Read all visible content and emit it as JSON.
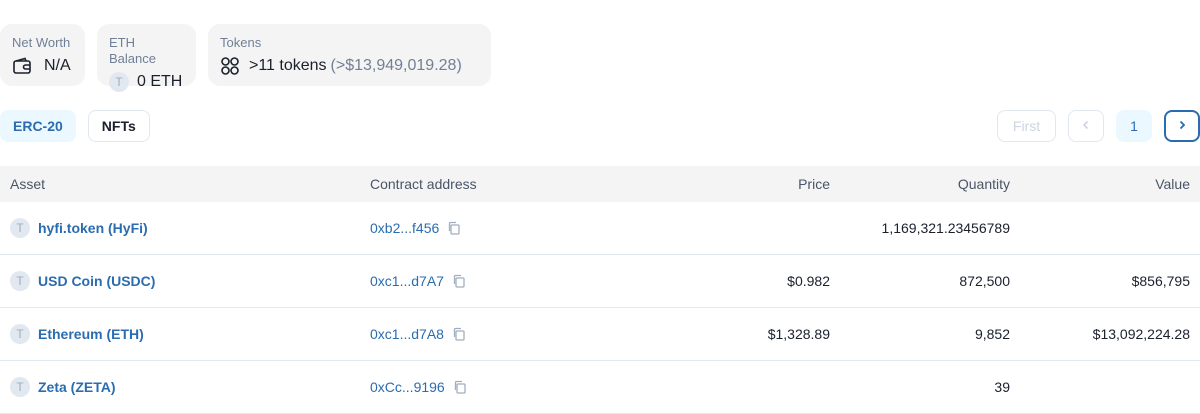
{
  "stats": {
    "net_worth": {
      "label": "Net Worth",
      "value": "N/A",
      "icon": "wallet-icon"
    },
    "eth_balance": {
      "label": "ETH Balance",
      "badge": "T",
      "value": "0 ETH"
    },
    "tokens": {
      "label": "Tokens",
      "count": ">11 tokens",
      "amount": "(>$13,949,019.28)",
      "icon": "tokens-icon"
    }
  },
  "tabs": [
    {
      "label": "ERC-20",
      "active": true
    },
    {
      "label": "NFTs",
      "active": false
    }
  ],
  "pagination": {
    "first": "First",
    "current_page": "1"
  },
  "table": {
    "headers": {
      "asset": "Asset",
      "contract": "Contract address",
      "price": "Price",
      "quantity": "Quantity",
      "value": "Value"
    },
    "rows": [
      {
        "badge": "T",
        "asset": "hyfi.token (HyFi)",
        "contract": "0xb2...f456",
        "price": "",
        "quantity": "1,169,321.23456789",
        "value": ""
      },
      {
        "badge": "T",
        "asset": "USD Coin (USDC)",
        "contract": "0xc1...d7A7",
        "price": "$0.982",
        "quantity": "872,500",
        "value": "$856,795"
      },
      {
        "badge": "T",
        "asset": "Ethereum (ETH)",
        "contract": "0xc1...d7A8",
        "price": "$1,328.89",
        "quantity": "9,852",
        "value": "$13,092,224.28"
      },
      {
        "badge": "T",
        "asset": "Zeta (ZETA)",
        "contract": "0xCc...9196",
        "price": "",
        "quantity": "39",
        "value": ""
      }
    ]
  },
  "colors": {
    "accent": "#2b6cb0",
    "muted": "#718096",
    "panel": "#f4f4f5"
  }
}
